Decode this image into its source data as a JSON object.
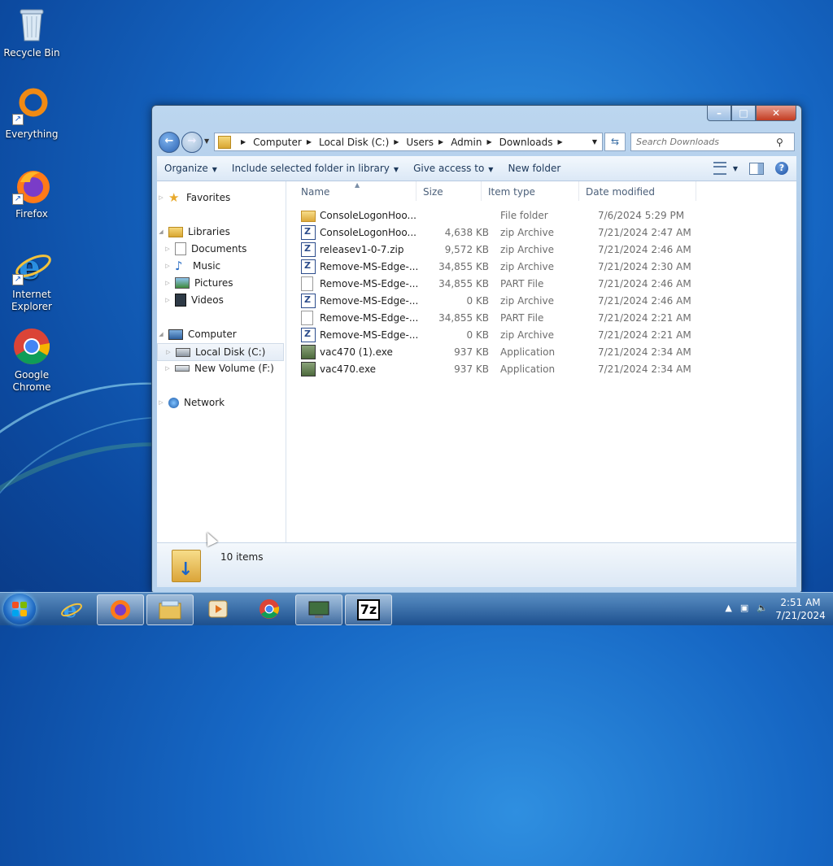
{
  "desktop": {
    "icons": [
      {
        "label": "Recycle Bin",
        "icon": "recycle-bin-icon"
      },
      {
        "label": "Everything",
        "icon": "everything-icon"
      },
      {
        "label": "Firefox",
        "icon": "firefox-icon"
      },
      {
        "label": "Internet Explorer",
        "icon": "internet-explorer-icon"
      },
      {
        "label": "Google Chrome",
        "icon": "chrome-icon"
      }
    ]
  },
  "window": {
    "caption": {
      "minimize": "–",
      "maximize": "□",
      "close": "✕"
    },
    "address": {
      "crumbs": [
        "Computer",
        "Local Disk (C:)",
        "Users",
        "Admin",
        "Downloads"
      ]
    },
    "search": {
      "placeholder": "Search Downloads"
    },
    "toolbar": {
      "organize": "Organize",
      "include_in_library": "Include selected folder in library",
      "give_access": "Give access to",
      "new_folder": "New folder"
    },
    "nav": {
      "favorites": "Favorites",
      "libraries": "Libraries",
      "documents": "Documents",
      "music": "Music",
      "pictures": "Pictures",
      "videos": "Videos",
      "computer": "Computer",
      "local_disk": "Local Disk (C:)",
      "new_volume": "New Volume (F:)",
      "network": "Network"
    },
    "columns": {
      "name": "Name",
      "size": "Size",
      "type": "Item type",
      "modified": "Date modified"
    },
    "files": [
      {
        "name": "ConsoleLogonHoo...",
        "size": "",
        "type": "File folder",
        "modified": "7/6/2024 5:29 PM",
        "icon": "folder"
      },
      {
        "name": "ConsoleLogonHoo...",
        "size": "4,638 KB",
        "type": "zip Archive",
        "modified": "7/21/2024 2:47 AM",
        "icon": "zip"
      },
      {
        "name": "releasev1-0-7.zip",
        "size": "9,572 KB",
        "type": "zip Archive",
        "modified": "7/21/2024 2:46 AM",
        "icon": "zip"
      },
      {
        "name": "Remove-MS-Edge-...",
        "size": "34,855 KB",
        "type": "zip Archive",
        "modified": "7/21/2024 2:30 AM",
        "icon": "zip"
      },
      {
        "name": "Remove-MS-Edge-...",
        "size": "34,855 KB",
        "type": "PART File",
        "modified": "7/21/2024 2:46 AM",
        "icon": "part"
      },
      {
        "name": "Remove-MS-Edge-...",
        "size": "0 KB",
        "type": "zip Archive",
        "modified": "7/21/2024 2:46 AM",
        "icon": "zip"
      },
      {
        "name": "Remove-MS-Edge-...",
        "size": "34,855 KB",
        "type": "PART File",
        "modified": "7/21/2024 2:21 AM",
        "icon": "part"
      },
      {
        "name": "Remove-MS-Edge-...",
        "size": "0 KB",
        "type": "zip Archive",
        "modified": "7/21/2024 2:21 AM",
        "icon": "zip"
      },
      {
        "name": "vac470 (1).exe",
        "size": "937 KB",
        "type": "Application",
        "modified": "7/21/2024 2:34 AM",
        "icon": "exe"
      },
      {
        "name": "vac470.exe",
        "size": "937 KB",
        "type": "Application",
        "modified": "7/21/2024 2:34 AM",
        "icon": "exe"
      }
    ],
    "status": {
      "item_count": "10 items"
    }
  },
  "taskbar": {
    "apps": [
      "internet-explorer",
      "firefox",
      "file-explorer",
      "media-player",
      "chrome",
      "remote-desktop",
      "7zip"
    ],
    "clock": {
      "time": "2:51 AM",
      "date": "7/21/2024"
    },
    "sevenzip_label": "7z"
  },
  "colors": {
    "accent": "#1f6ac3",
    "window_frame": "#a9c7e7",
    "desktop": "#1667c4"
  }
}
